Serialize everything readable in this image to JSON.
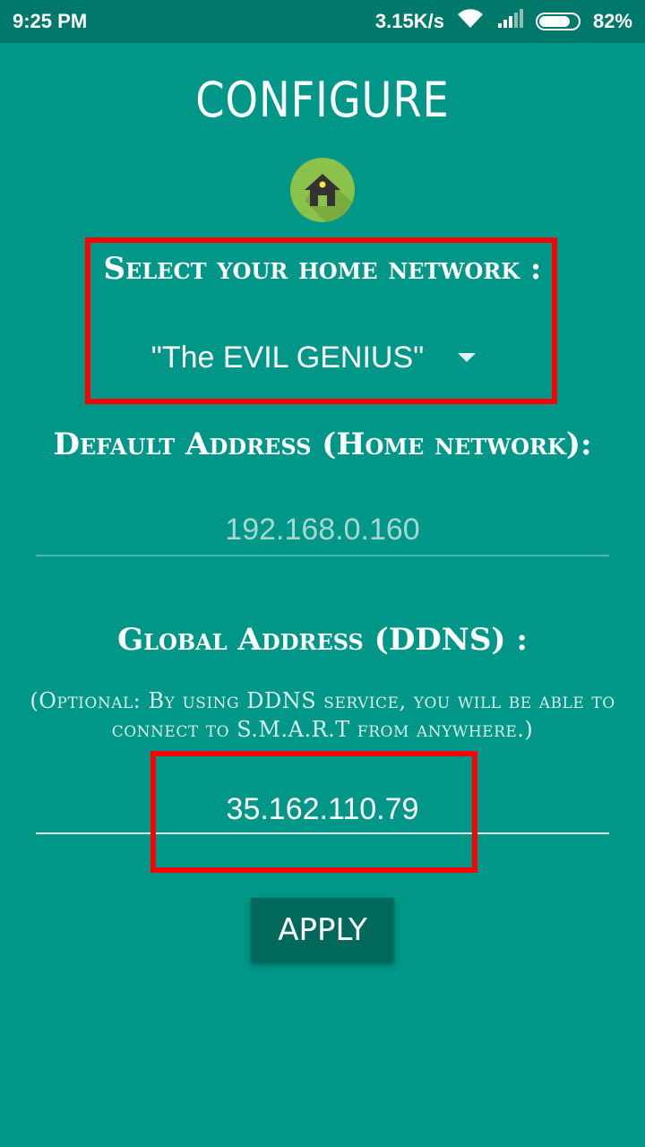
{
  "status_bar": {
    "time": "9:25 PM",
    "net_speed": "3.15K/s",
    "battery_percent": "82%",
    "battery_level": 0.82,
    "icons": [
      "wifi-icon",
      "signal-icon",
      "battery-icon"
    ]
  },
  "title": "CONFIGURE",
  "logo": "home-icon",
  "home_network": {
    "label": "Select your home network :",
    "selected": "\"The EVIL GENIUS\""
  },
  "default_address": {
    "label": "Default Address (Home network):",
    "value": "192.168.0.160"
  },
  "global_address": {
    "label": "Global Address (DDNS) :",
    "note": "(Optional: By using DDNS service, you will be able to connect to S.M.A.R.T from anywhere.)",
    "value": "35.162.110.79"
  },
  "apply_label": "APPLY",
  "colors": {
    "background": "#009688",
    "status_bar": "#00796b",
    "button": "#00695c",
    "highlight": "#ff0000",
    "logo": "#8bc34a"
  }
}
